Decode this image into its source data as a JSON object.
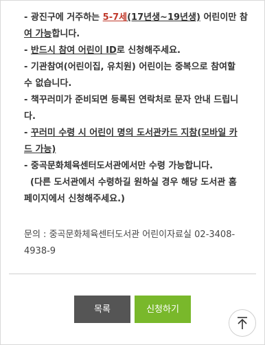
{
  "notice": {
    "line1_pre": "- 광진구에 거주하는 ",
    "line1_age": "5-7세",
    "line1_years": "(17년생~19년생)",
    "line1_post": " 어린이만 참",
    "line2_pre": "여 가능",
    "line2_post": "합니다.",
    "line3_pre": "- ",
    "line3_link": "반드시 참여 어린이 ID",
    "line3_post": "로 신청해주세요.",
    "line4": "- 기관참여(어린이집, 유치원) 어린이는 중복으로 참여할",
    "line5": "수 없습니다.",
    "line6": "- 책꾸러미가 준비되면 등록된 연락처로 문자 안내 드립니",
    "line7": "다.",
    "line8_pre": "- ",
    "line8_link": "꾸러미 수령 시 어린이 명의 도서관카드 지참(모바일 카",
    "line9_link": "드 가능)",
    "line10": "- 중곡문화체육센터도서관에서만 수령 가능합니다.",
    "line11": "  (다른 도서관에서 수령하길 원하실 경우 해당 도서관 홈",
    "line12": "페이지에서 신청해주세요.)"
  },
  "contact": {
    "line1": "문의 : 중곡문화체육센터도서관 어린이자료실 02-3408-",
    "line2": "4938-9"
  },
  "buttons": {
    "list_label": "목록",
    "apply_label": "신청하기"
  },
  "colors": {
    "list_button": "#555555",
    "apply_button": "#79b82b",
    "highlight": "#c0392b"
  },
  "icons": {
    "scroll_top": "arrow-up-to-top-icon"
  }
}
